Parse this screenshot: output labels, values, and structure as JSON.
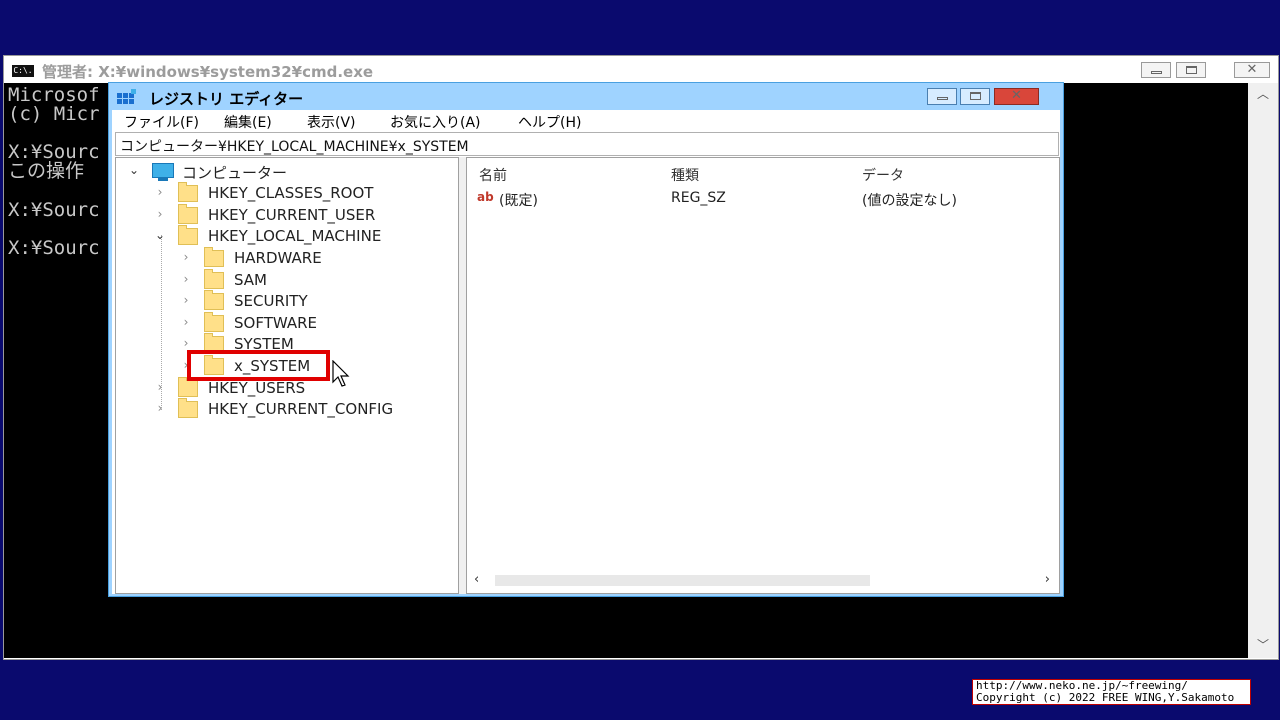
{
  "cmd": {
    "icon_text": "C:\\.",
    "title": "管理者: X:¥windows¥system32¥cmd.exe",
    "lines": [
      "Microsof",
      "(c) Micr",
      "",
      "X:¥Sourc",
      "この操作",
      "",
      "X:¥Sourc",
      "",
      "X:¥Sourc"
    ]
  },
  "regedit": {
    "title": "レジストリ エディター",
    "menu": [
      "ファイル(F)",
      "編集(E)",
      "表示(V)",
      "お気に入り(A)",
      "ヘルプ(H)"
    ],
    "address": "コンピューター¥HKEY_LOCAL_MACHINE¥x_SYSTEM",
    "tree": {
      "root": "コンピューター",
      "hives": [
        "HKEY_CLASSES_ROOT",
        "HKEY_CURRENT_USER",
        "HKEY_LOCAL_MACHINE"
      ],
      "hklm_children": [
        "HARDWARE",
        "SAM",
        "SECURITY",
        "SOFTWARE",
        "SYSTEM",
        "x_SYSTEM"
      ],
      "hives_after": [
        "HKEY_USERS",
        "HKEY_CURRENT_CONFIG"
      ],
      "selected": "x_SYSTEM"
    },
    "columns": [
      "名前",
      "種類",
      "データ"
    ],
    "values": [
      {
        "icon": "ab",
        "name": "(既定)",
        "type": "REG_SZ",
        "data": "(値の設定なし)"
      }
    ]
  },
  "copyright": {
    "line1": "http://www.neko.ne.jp/~freewing/",
    "line2": "Copyright (c) 2022 FREE WING,Y.Sakamoto"
  }
}
